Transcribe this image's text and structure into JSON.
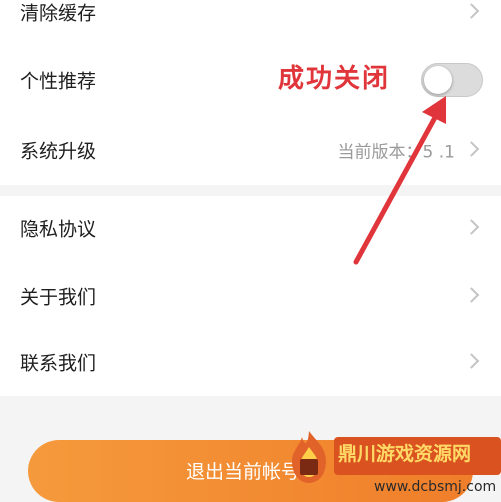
{
  "settings": {
    "items": [
      {
        "label": "清除缓存"
      },
      {
        "label": "个性推荐"
      },
      {
        "label": "系统升级",
        "value": "当前版本：5 .1"
      },
      {
        "label": "隐私协议"
      },
      {
        "label": "关于我们"
      },
      {
        "label": "联系我们"
      }
    ]
  },
  "toggle": {
    "state": "off"
  },
  "annotation": {
    "text": "成功关闭",
    "color": "#e0353a"
  },
  "logout": {
    "label": "退出当前帐号",
    "color": "#f28b32"
  },
  "watermark": {
    "title": "鼎川游戏资源网",
    "url": "www.dcbsmj.com"
  }
}
